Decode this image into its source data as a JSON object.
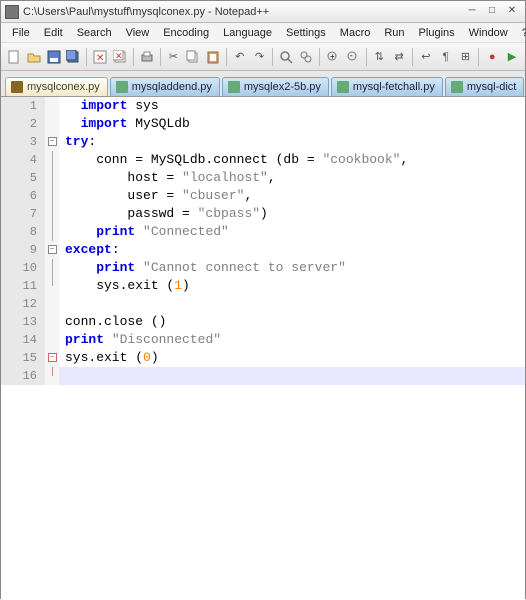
{
  "window": {
    "title": "C:\\Users\\Paul\\mystuff\\mysqlconex.py - Notepad++"
  },
  "menu": {
    "file": "File",
    "edit": "Edit",
    "search": "Search",
    "view": "View",
    "encoding": "Encoding",
    "language": "Language",
    "settings": "Settings",
    "macro": "Macro",
    "run": "Run",
    "plugins": "Plugins",
    "window": "Window",
    "help": "?"
  },
  "tabs": {
    "t1": "mysqlconex.py",
    "t2": "mysqladdend.py",
    "t3": "mysqlex2-5b.py",
    "t4": "mysql-fetchall.py",
    "t5": "mysql-dict"
  },
  "gutter": {
    "l1": "1",
    "l2": "2",
    "l3": "3",
    "l4": "4",
    "l5": "5",
    "l6": "6",
    "l7": "7",
    "l8": "8",
    "l9": "9",
    "l10": "10",
    "l11": "11",
    "l12": "12",
    "l13": "13",
    "l14": "14",
    "l15": "15",
    "l16": "16"
  },
  "code": {
    "l1a": "import",
    "l1b": " sys",
    "l2a": "import",
    "l2b": " MySQLdb",
    "l3a": "try",
    "l3b": ":",
    "l4a": "    conn = MySQLdb.connect (db = ",
    "l4b": "\"cookbook\"",
    "l4c": ",",
    "l5a": "        host = ",
    "l5b": "\"localhost\"",
    "l5c": ",",
    "l6a": "        user = ",
    "l6b": "\"cbuser\"",
    "l6c": ",",
    "l7a": "        passwd = ",
    "l7b": "\"cbpass\"",
    "l7c": ")",
    "l8a": "    ",
    "l8b": "print",
    "l8c": " ",
    "l8d": "\"Connected\"",
    "l9a": "except",
    "l9b": ":",
    "l10a": "    ",
    "l10b": "print",
    "l10c": " ",
    "l10d": "\"Cannot connect to server\"",
    "l11a": "    sys.exit (",
    "l11b": "1",
    "l11c": ")",
    "l12a": "",
    "l13a": "conn.close ()",
    "l14a": "print",
    "l14b": " ",
    "l14c": "\"Disconnected\"",
    "l15a": "sys.exit (",
    "l15b": "0",
    "l15c": ")",
    "l16a": ""
  }
}
